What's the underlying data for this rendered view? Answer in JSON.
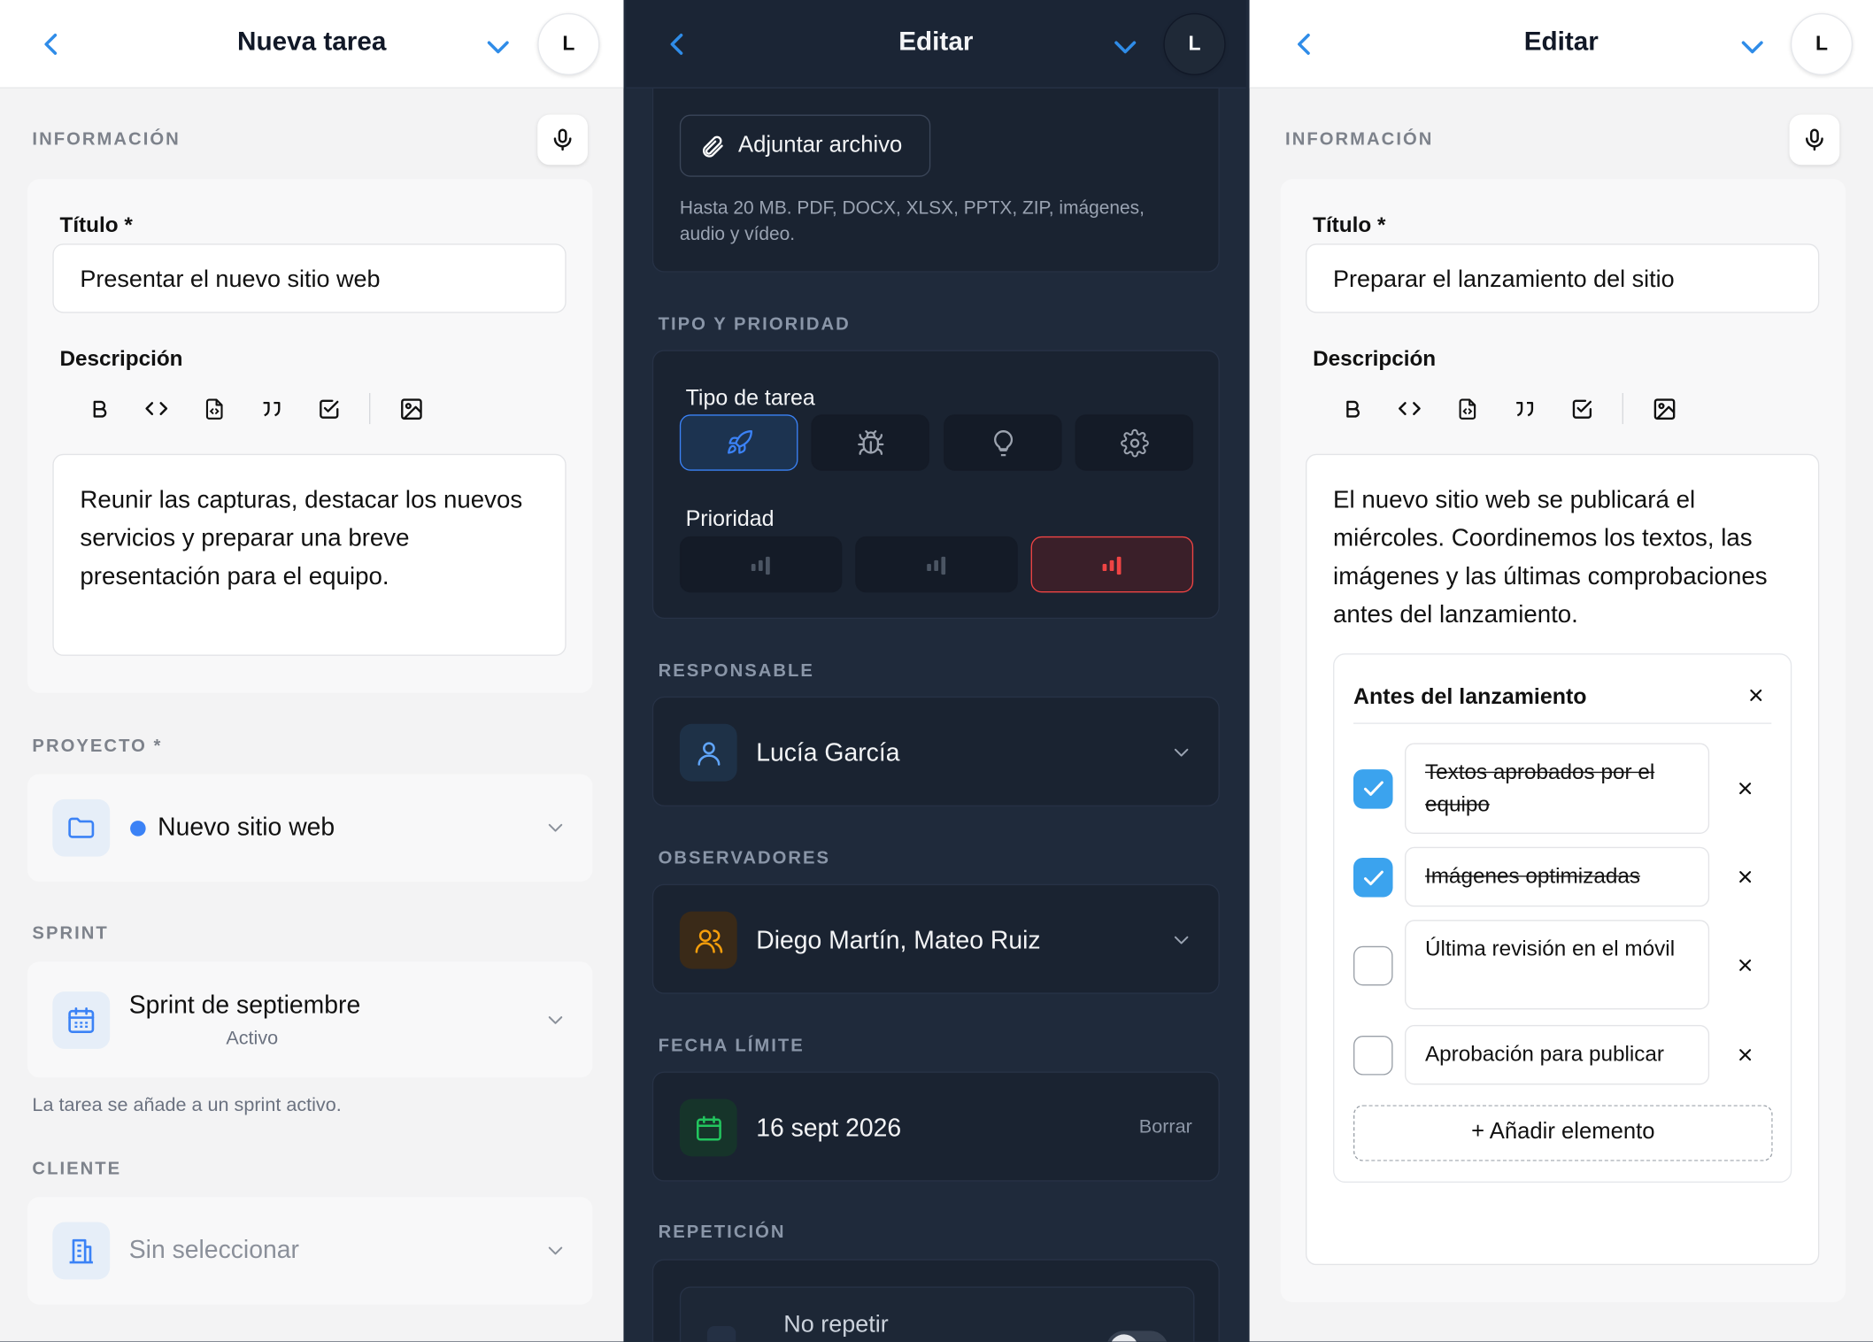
{
  "panels": {
    "left": {
      "title": "Nueva tarea",
      "avatar": "L",
      "section_info": "INFORMACIÓN",
      "title_label": "Título *",
      "title_value": "Presentar el nuevo sitio web",
      "desc_label": "Descripción",
      "desc_value": "Reunir las capturas, destacar los nuevos servicios y preparar una breve presentación para el equipo.",
      "section_project": "PROYECTO *",
      "project_value": "Nuevo sitio web",
      "project_color": "#3b82f6",
      "section_sprint": "SPRINT",
      "sprint_value": "Sprint de septiembre",
      "sprint_status": "Activo",
      "sprint_hint": "La tarea se añade a un sprint activo.",
      "section_client": "CLIENTE",
      "client_placeholder": "Sin seleccionar"
    },
    "middle": {
      "title": "Editar",
      "avatar": "L",
      "attach_label": "Adjuntar archivo",
      "attach_hint": "Hasta 20 MB. PDF, DOCX, XLSX, PPTX, ZIP, imágenes, audio y vídeo.",
      "section_type": "TIPO Y PRIORIDAD",
      "type_label": "Tipo de tarea",
      "task_types": [
        "rocket-icon",
        "bug-icon",
        "lightbulb-icon",
        "gear-icon"
      ],
      "task_type_selected": 0,
      "priority_label": "Prioridad",
      "priority_selected": 2,
      "section_assignee": "RESPONSABLE",
      "assignee_value": "Lucía García",
      "section_watchers": "OBSERVADORES",
      "watchers_value": "Diego Martín, Mateo Ruiz",
      "section_due": "FECHA LÍMITE",
      "due_value": "16 sept 2026",
      "due_clear": "Borrar",
      "section_repeat": "REPETICIÓN",
      "repeat_value": "No repetir",
      "accent": "#3b82f6",
      "danger": "#ef4444"
    },
    "right": {
      "title": "Editar",
      "avatar": "L",
      "section_info": "INFORMACIÓN",
      "title_label": "Título *",
      "title_value": "Preparar el lanzamiento del sitio",
      "desc_label": "Descripción",
      "desc_value": "El nuevo sitio web se publicará el miércoles. Coordinemos los textos, las imágenes y las últimas comprobaciones antes del lanzamiento.",
      "checklist_title": "Antes del lanzamiento",
      "checklist": [
        {
          "text": "Textos aprobados por el equipo",
          "done": true
        },
        {
          "text": "Imágenes optimizadas",
          "done": true
        },
        {
          "text": "Última revisión en el móvil",
          "done": false
        },
        {
          "text": "Aprobación para publicar",
          "done": false
        }
      ],
      "add_item": "+ Añadir elemento"
    }
  },
  "toolbar_icons": [
    "bold-icon",
    "code-icon",
    "code-file-icon",
    "quote-icon",
    "checkbox-icon",
    "image-icon"
  ]
}
